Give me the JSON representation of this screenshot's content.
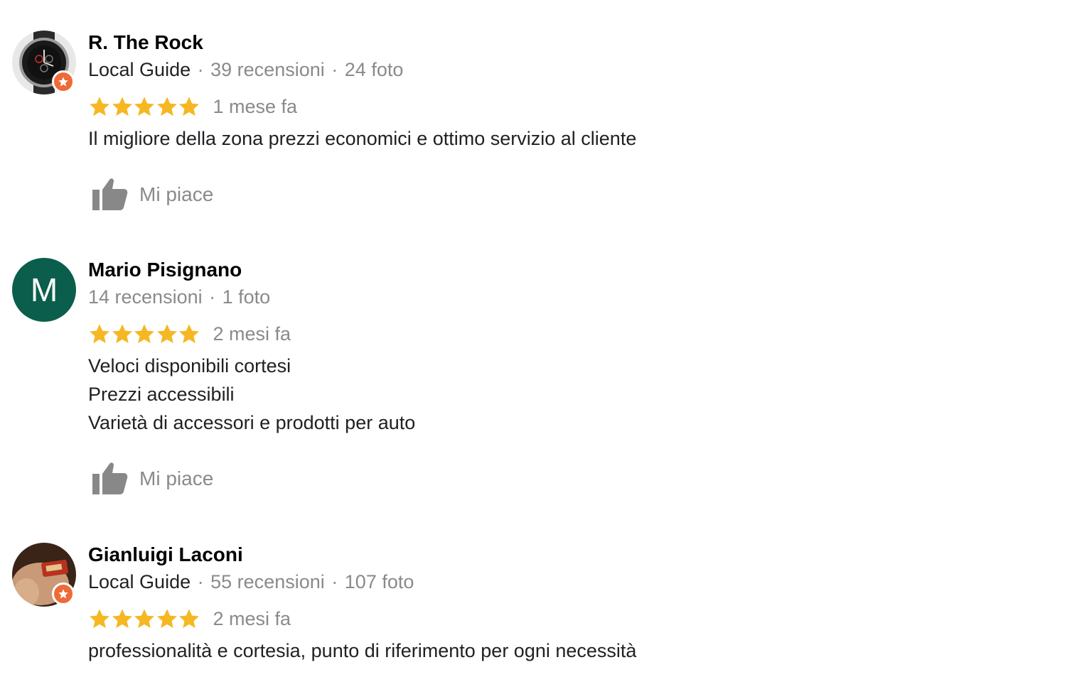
{
  "reviews": [
    {
      "name": "R. The Rock",
      "local_guide": "Local Guide",
      "reviews_count": "39 recensioni",
      "photos_count": "24 foto",
      "stars": 5,
      "date": "1 mese fa",
      "text_lines": [
        "Il migliore della zona prezzi economici e ottimo servizio al cliente"
      ],
      "like_label": "Mi piace",
      "avatar": "watch-photo"
    },
    {
      "name": "Mario Pisignano",
      "local_guide": "",
      "reviews_count": "14 recensioni",
      "photos_count": "1 foto",
      "stars": 5,
      "date": "2 mesi fa",
      "text_lines": [
        "Veloci disponibili cortesi",
        "Prezzi accessibili",
        "Varietà di accessori e prodotti per auto"
      ],
      "like_label": "Mi piace",
      "avatar_letter": "M",
      "avatar_color": "#0b5e4b"
    },
    {
      "name": "Gianluigi Laconi",
      "local_guide": "Local Guide",
      "reviews_count": "55 recensioni",
      "photos_count": "107 foto",
      "stars": 5,
      "date": "2 mesi fa",
      "text_lines": [
        "professionalità e cortesia, punto di riferimento per ogni necessità"
      ],
      "avatar": "hand-photo"
    }
  ],
  "colors": {
    "star": "#f5b823",
    "badge": "#ee6a37",
    "muted": "#8a8a8a"
  },
  "separator": "·"
}
